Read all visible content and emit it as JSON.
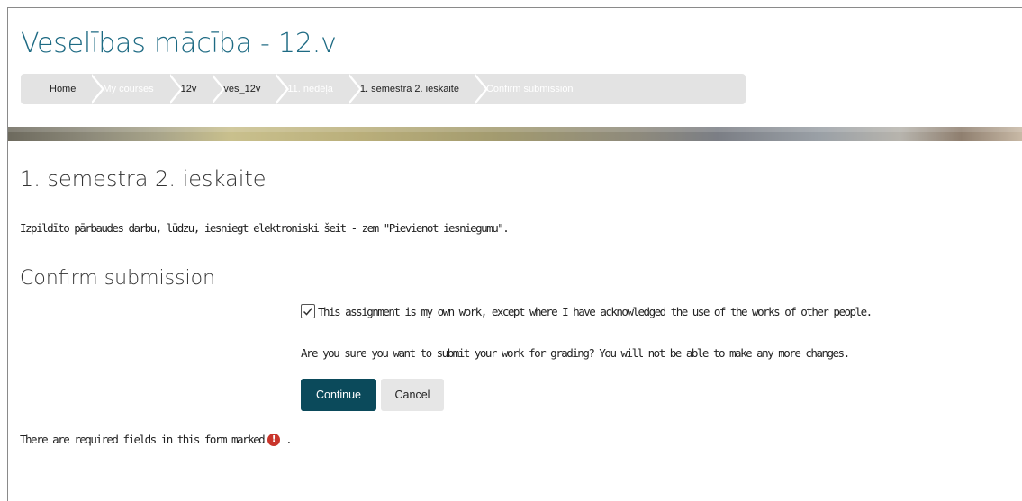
{
  "course": {
    "title": "Veselības mācība - 12.v"
  },
  "breadcrumb": [
    {
      "label": "Home",
      "dim": false
    },
    {
      "label": "My courses",
      "dim": true
    },
    {
      "label": "12v",
      "dim": false
    },
    {
      "label": "ves_12v",
      "dim": false
    },
    {
      "label": "11. nedēļa",
      "dim": true
    },
    {
      "label": "1. semestra 2. ieskaite",
      "dim": false
    },
    {
      "label": "Confirm submission",
      "dim": true
    }
  ],
  "main": {
    "heading": "1. semestra 2. ieskaite",
    "intro": "Izpildīto pārbaudes darbu, lūdzu, iesniegt elektroniski šeit - zem \"Pievienot iesniegumu\".",
    "section_heading": "Confirm submission",
    "statement_label": "This assignment is my own work, except where I have acknowledged the use of the works of other people.",
    "statement_checked": true,
    "confirm_question": "Are you sure you want to submit your work for grading? You will not be able to make any more changes.",
    "continue_label": "Continue",
    "cancel_label": "Cancel",
    "required_note_prefix": "There are required fields in this form marked",
    "required_note_suffix": ".",
    "required_icon": "exclamation-circle-icon"
  },
  "colors": {
    "title": "#1d6a83",
    "primary_button": "#0b4a5b",
    "required_icon": "#c9352b",
    "breadcrumb_bg": "#e3e3e3"
  }
}
